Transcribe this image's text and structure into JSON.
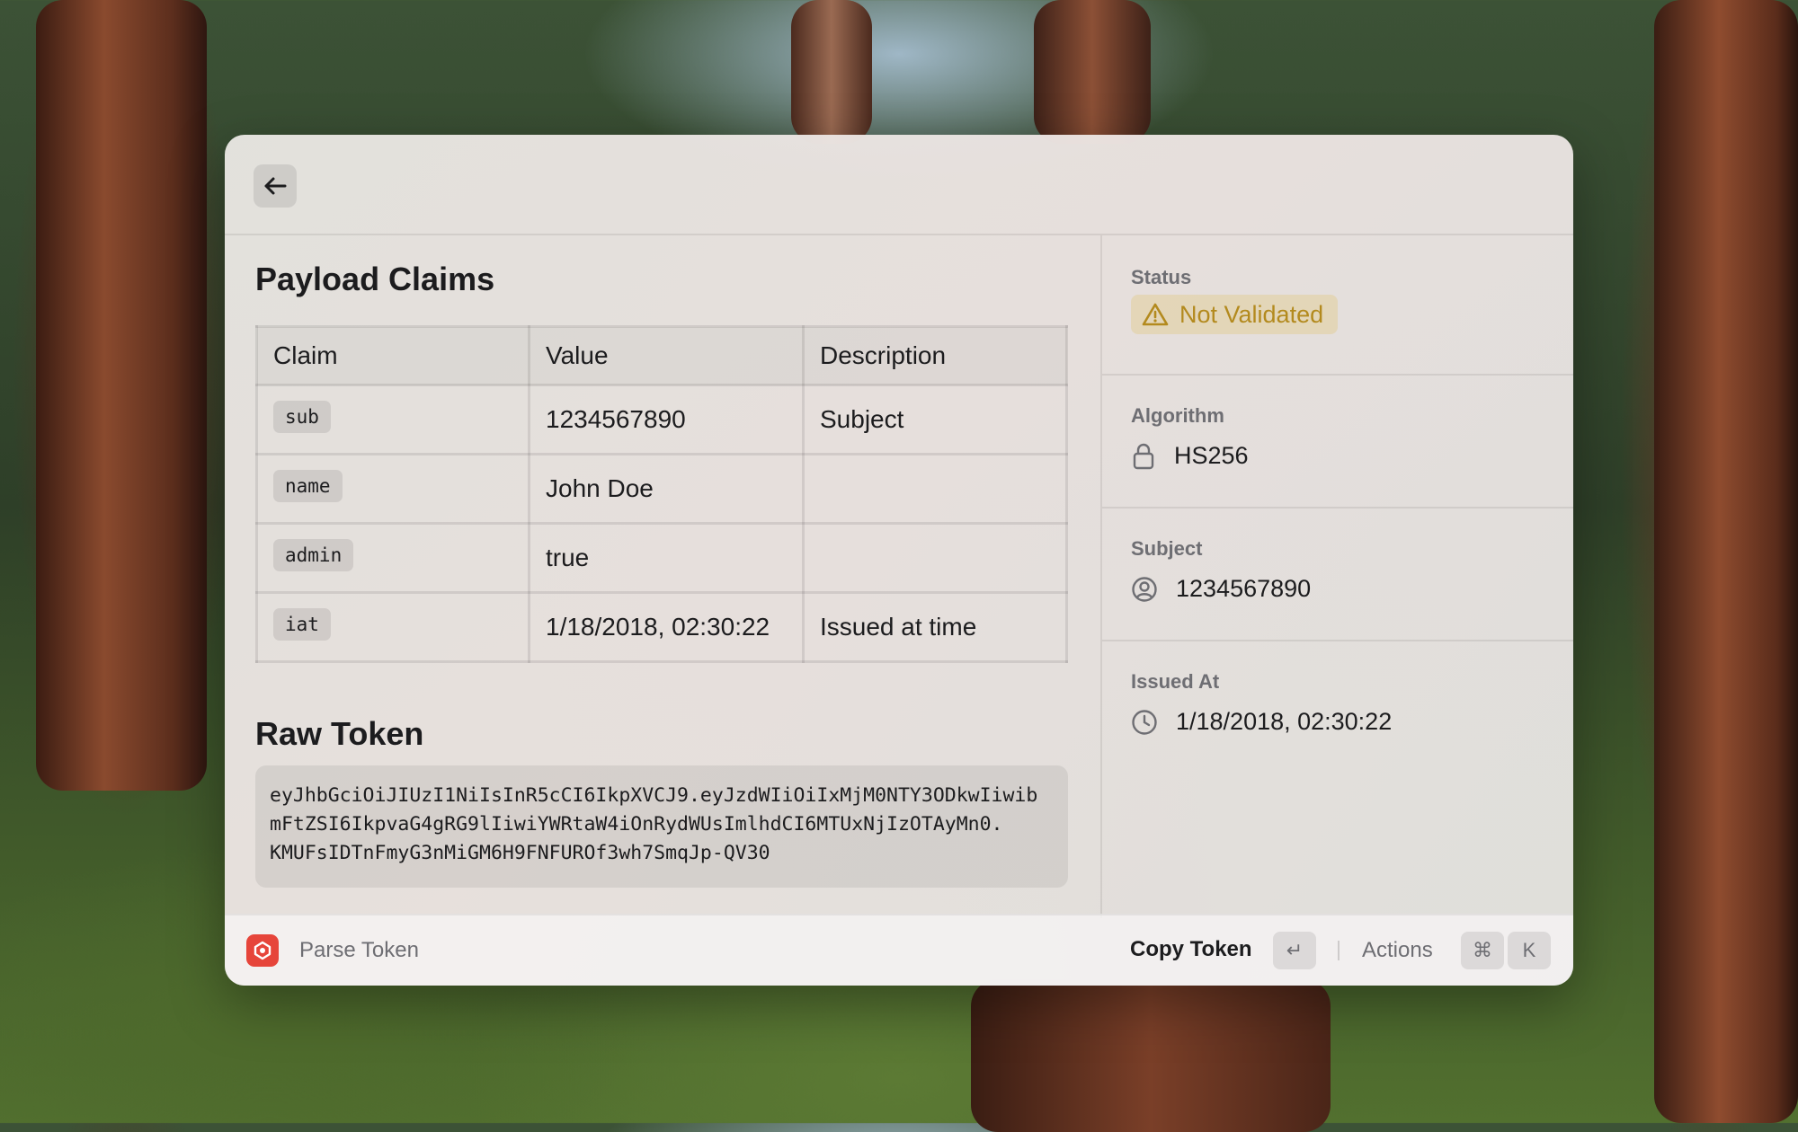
{
  "header": {
    "back_icon": "arrow-left-icon"
  },
  "payload": {
    "title": "Payload Claims",
    "columns": [
      "Claim",
      "Value",
      "Description"
    ],
    "rows": [
      {
        "claim": "sub",
        "value": "1234567890",
        "description": "Subject"
      },
      {
        "claim": "name",
        "value": "John Doe",
        "description": ""
      },
      {
        "claim": "admin",
        "value": "true",
        "description": ""
      },
      {
        "claim": "iat",
        "value": "1/18/2018, 02:30:22",
        "description": "Issued at time"
      }
    ]
  },
  "raw": {
    "title": "Raw Token",
    "lines": [
      "eyJhbGciOiJIUzI1NiIsInR5cCI6IkpXVCJ9.eyJzdWIiOiIxMjM0NTY3ODkwIiwib",
      "mFtZSI6IkpvaG4gRG9lIiwiYWRtaW4iOnRydWUsImlhdCI6MTUxNjIzOTAyMn0.",
      "KMUFsIDTnFmyG3nMiGM6H9FNFUROf3wh7SmqJp-QV30"
    ]
  },
  "sidebar": {
    "status_label": "Status",
    "status_value": "Not Validated",
    "status_color": "#b38a1e",
    "algorithm_label": "Algorithm",
    "algorithm_value": "HS256",
    "subject_label": "Subject",
    "subject_value": "1234567890",
    "issued_label": "Issued At",
    "issued_value": "1/18/2018, 02:30:22"
  },
  "footer": {
    "app_name": "Parse Token",
    "primary_action": "Copy Token",
    "primary_key": "↵",
    "actions_label": "Actions",
    "actions_key_1": "⌘",
    "actions_key_2": "K",
    "accent": "#e6453a"
  }
}
